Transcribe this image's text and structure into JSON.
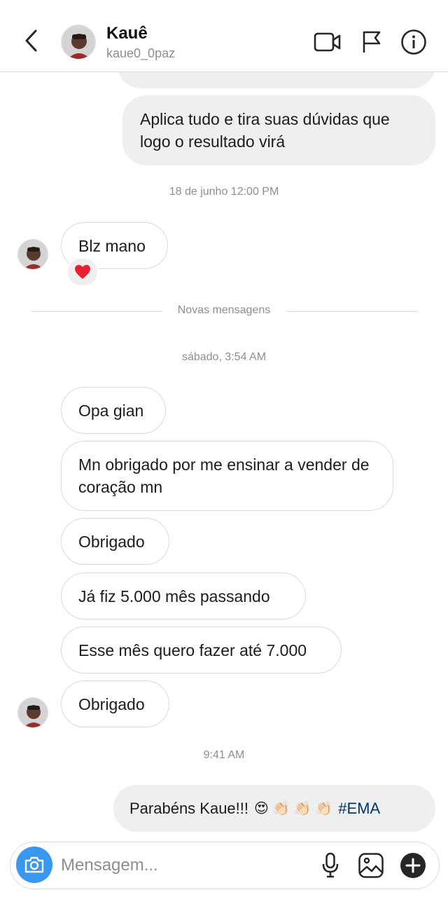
{
  "header": {
    "name": "Kauê",
    "username": "kaue0_0paz"
  },
  "messages": {
    "out_1": "Aplica tudo e tira suas dúvidas que logo o resultado virá",
    "stamp_1": "18 de junho 12:00 PM",
    "in_1": "Blz mano",
    "reaction_1": "❤️",
    "divider": "Novas mensagens",
    "stamp_2": "sábado, 3:54 AM",
    "in_2": "Opa gian",
    "in_3": "Mn obrigado por me ensinar a vender de coração mn",
    "in_4": "Obrigado",
    "in_5": "Já fiz 5.000 mês passando",
    "in_6": "Esse mês quero fazer até 7.000",
    "in_7": "Obrigado",
    "stamp_3": "9:41 AM",
    "out_2_text": "Parabéns Kaue!!!",
    "out_2_emojis": "😍 👏🏻 👏🏻 👏🏻",
    "out_2_hashtag": "#EMA"
  },
  "composer": {
    "placeholder": "Mensagem..."
  },
  "icons": {
    "back": "chevron-left-icon",
    "video": "video-camera-icon",
    "flag": "flag-icon",
    "info": "info-icon",
    "camera": "camera-icon",
    "mic": "microphone-icon",
    "gallery": "image-icon",
    "add": "plus-circle-icon"
  },
  "colors": {
    "accent": "#3897f0",
    "hashtag": "#00376b",
    "outgoing_bubble": "#efefef",
    "incoming_border": "#dadada"
  }
}
